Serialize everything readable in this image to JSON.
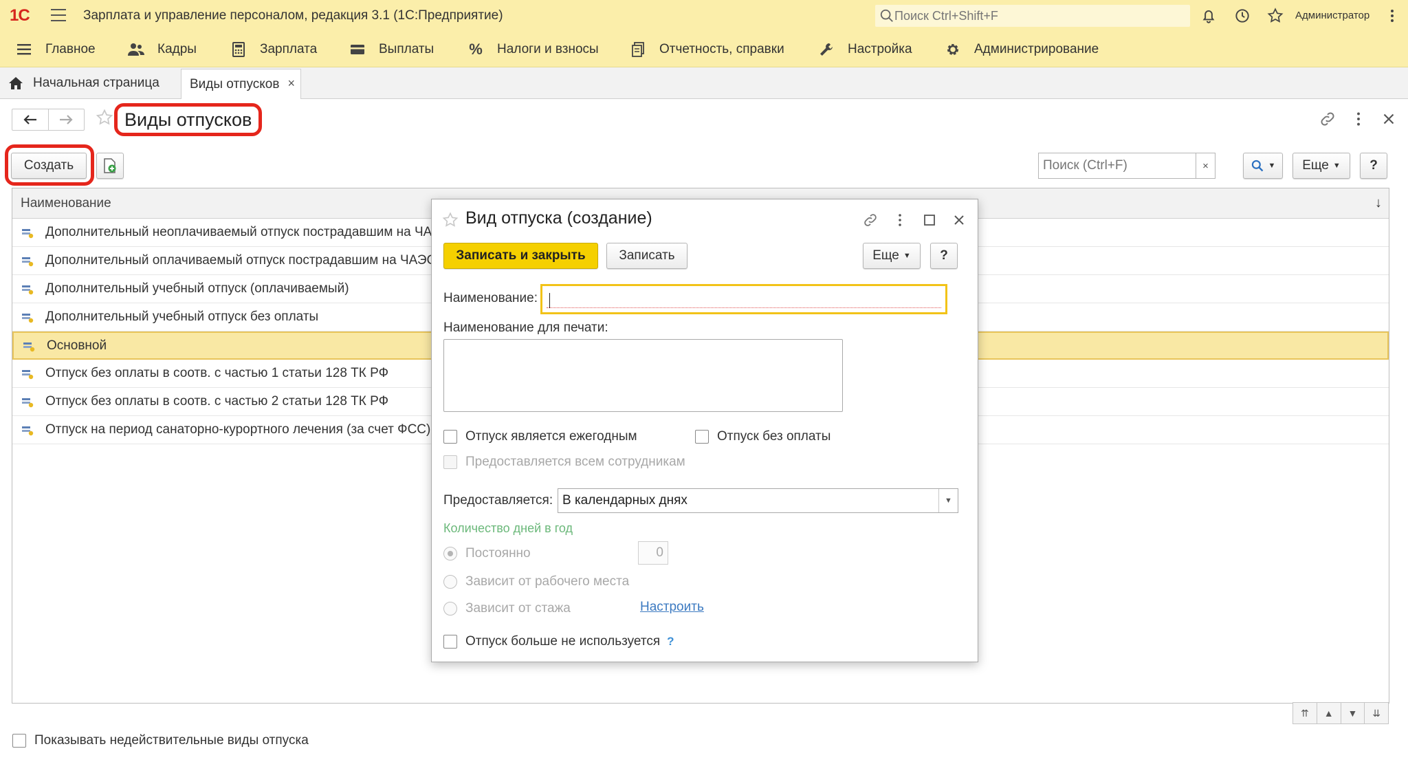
{
  "app": {
    "logo": "1С",
    "title": "Зарплата и управление персоналом, редакция 3.1  (1С:Предприятие)",
    "search_placeholder": "Поиск Ctrl+Shift+F",
    "user": "Администратор"
  },
  "sections": [
    {
      "label": "Главное",
      "icon": "menu-icon"
    },
    {
      "label": "Кадры",
      "icon": "people-icon"
    },
    {
      "label": "Зарплата",
      "icon": "calculator-icon"
    },
    {
      "label": "Выплаты",
      "icon": "wallet-icon"
    },
    {
      "label": "Налоги и взносы",
      "icon": "percent-icon"
    },
    {
      "label": "Отчетность, справки",
      "icon": "reports-icon"
    },
    {
      "label": "Настройка",
      "icon": "wrench-icon"
    },
    {
      "label": "Администрирование",
      "icon": "gear-icon"
    }
  ],
  "tabs": {
    "home": "Начальная страница",
    "active": "Виды отпусков",
    "close": "×"
  },
  "form": {
    "title": "Виды отпусков",
    "create_label": "Создать",
    "search_placeholder": "Поиск (Ctrl+F)",
    "search_clear": "×",
    "more_label": "Еще",
    "help_label": "?"
  },
  "list": {
    "column": "Наименование",
    "sort_icon": "↓",
    "rows": [
      "Дополнительный неоплачиваемый отпуск пострадавшим на ЧАЭС",
      "Дополнительный оплачиваемый отпуск пострадавшим на ЧАЭС",
      "Дополнительный учебный отпуск (оплачиваемый)",
      "Дополнительный учебный отпуск без оплаты",
      "Основной",
      "Отпуск без оплаты в соотв. с частью 1 статьи 128 ТК РФ",
      "Отпуск без оплаты в соотв. с частью 2 статьи 128 ТК РФ",
      "Отпуск на период санаторно-курортного лечения (за счет ФСС)"
    ],
    "selected_index": 4,
    "scroll": [
      "⇈",
      "▲",
      "▼",
      "⇊"
    ]
  },
  "footer": {
    "show_invalid_label": "Показывать недействительные виды отпуска"
  },
  "dialog": {
    "title": "Вид отпуска (создание)",
    "save_close_label": "Записать и закрыть",
    "save_label": "Записать",
    "more_label": "Еще",
    "help_label": "?",
    "name_label": "Наименование:",
    "name_value": "",
    "print_name_label": "Наименование для печати:",
    "print_name_value": "",
    "annual_label": "Отпуск является ежегодным",
    "unpaid_label": "Отпуск без оплаты",
    "all_employees_label": "Предоставляется всем сотрудникам",
    "provided_label": "Предоставляется:",
    "provided_value": "В календарных днях",
    "days_group_title": "Количество дней в год",
    "radio_constant": "Постоянно",
    "radio_workplace": "Зависит от рабочего места",
    "radio_experience": "Зависит от стажа",
    "days_value": "0",
    "setup_link": "Настроить",
    "not_used_label": "Отпуск больше не используется",
    "not_used_help": "?"
  },
  "colors": {
    "brand_yellow": "#fbeeaa",
    "primary_button": "#f5d000",
    "highlight_red": "#e5261c",
    "selected_row": "#f9e8a4"
  }
}
